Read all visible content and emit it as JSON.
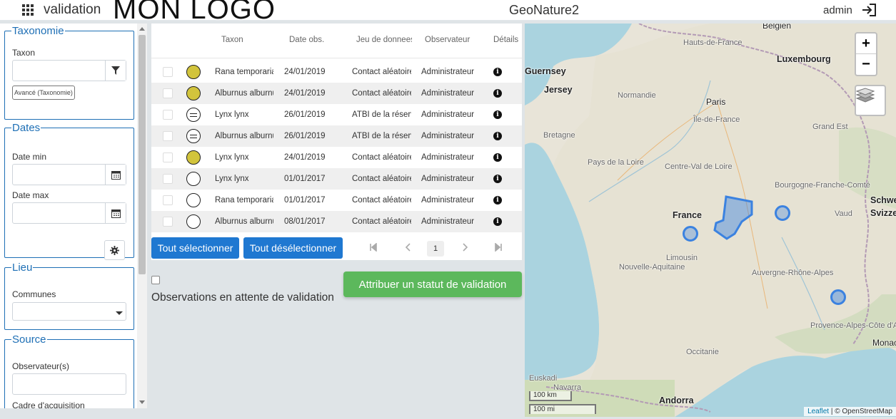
{
  "header": {
    "module_name": "validation",
    "logo": "MON LOGO",
    "app_title": "GeoNature2",
    "username": "admin"
  },
  "sidebar": {
    "taxonomie": {
      "legend": "Taxonomie",
      "taxon_label": "Taxon",
      "taxon_value": "",
      "advanced_button": "Avancé (Taxonomie)"
    },
    "dates": {
      "legend": "Dates",
      "date_min_label": "Date min",
      "date_min_value": "",
      "date_max_label": "Date max",
      "date_max_value": ""
    },
    "lieu": {
      "legend": "Lieu",
      "communes_label": "Communes",
      "communes_value": ""
    },
    "source": {
      "legend": "Source",
      "observateurs_label": "Observateur(s)",
      "observateurs_value": "",
      "cadre_label": "Cadre d'acquisition"
    }
  },
  "table": {
    "columns": [
      "Taxon",
      "Date obs.",
      "Jeu de donnees",
      "Observateur",
      "Détails"
    ],
    "rows": [
      {
        "status": "yellow",
        "taxon": "Rana temporaria",
        "date": "24/01/2019",
        "jdd": "Contact aléatoire",
        "observateur": "Administrateur"
      },
      {
        "status": "yellow",
        "taxon": "Alburnus alburnus",
        "date": "24/01/2019",
        "jdd": "Contact aléatoire",
        "observateur": "Administrateur"
      },
      {
        "status": "bars",
        "taxon": "Lynx lynx",
        "date": "26/01/2019",
        "jdd": "ATBI de la réserve",
        "observateur": "Administrateur"
      },
      {
        "status": "bars",
        "taxon": "Alburnus alburnus",
        "date": "26/01/2019",
        "jdd": "ATBI de la réserve",
        "observateur": "Administrateur"
      },
      {
        "status": "yellow",
        "taxon": "Lynx lynx",
        "date": "24/01/2019",
        "jdd": "Contact aléatoire",
        "observateur": "Administrateur"
      },
      {
        "status": "white",
        "taxon": "Lynx lynx",
        "date": "01/01/2017",
        "jdd": "Contact aléatoire",
        "observateur": "Administrateur"
      },
      {
        "status": "white",
        "taxon": "Rana temporaria",
        "date": "01/01/2017",
        "jdd": "Contact aléatoire",
        "observateur": "Administrateur"
      },
      {
        "status": "white",
        "taxon": "Alburnus alburnus",
        "date": "08/01/2017",
        "jdd": "Contact aléatoire",
        "observateur": "Administrateur"
      }
    ],
    "select_all": "Tout sélectionner",
    "deselect_all": "Tout désélectionner",
    "pagination": {
      "current_page": "1"
    }
  },
  "actions": {
    "waiting_label": "Observations en attente de validation",
    "attribute_button": "Attribuer un statut de validation"
  },
  "map": {
    "zoom_in": "+",
    "zoom_out": "−",
    "scale_km": "100 km",
    "scale_mi": "100 mi",
    "attribution_leaflet": "Leaflet",
    "attribution_osm": "| © OpenStreetMap",
    "labels": {
      "belgien": "Belgien",
      "luxembourg": "Luxembourg",
      "guernsey": "Guernsey",
      "jersey": "Jersey",
      "hauts_de_france": "Hauts-de-France",
      "normandie": "Normandie",
      "paris": "Paris",
      "ile_de_france": "Île-de-France",
      "grand_est": "Grand Est",
      "bretagne": "Bretagne",
      "pays_de_la_loire": "Pays de la Loire",
      "centre_val_de_loire": "Centre-Val de Loire",
      "bourgogne": "Bourgogne-Franche-Comté",
      "schweiz": "Schweiz",
      "suisse": "Suisse",
      "svizzera": "Svizzera",
      "vaud": "Vaud",
      "france": "France",
      "limousin": "Limousin",
      "nouvelle_aquitaine": "Nouvelle-Aquitaine",
      "auvergne": "Auvergne-Rhône-Alpes",
      "provence": "Provence-Alpes-Côte d'Azur",
      "occitanie": "Occitanie",
      "euskadi": "Euskadi",
      "navarra": "Navarra",
      "andorra": "Andorra",
      "monaco": "Monaco"
    }
  },
  "colors": {
    "accent": "#1e6fb5",
    "primary_button": "#1f78d1",
    "success_button": "#5cb85c",
    "status_yellow": "#d2c43c",
    "marker_blue": "#3b82e0"
  }
}
